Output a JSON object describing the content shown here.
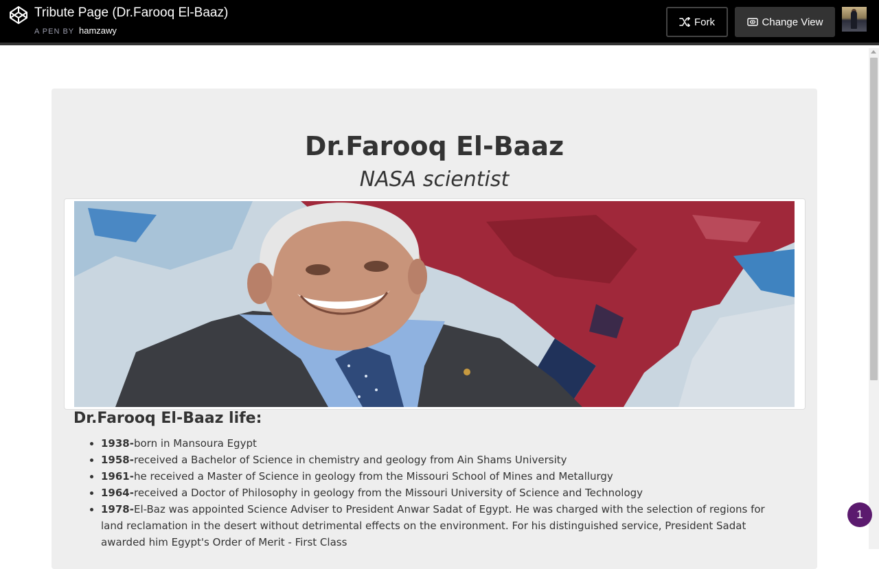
{
  "header": {
    "title": "Tribute Page (Dr.Farooq El-Baaz)",
    "byline_prefix": "A PEN BY",
    "author": "hamzawy",
    "fork_label": "Fork",
    "change_view_label": "Change View"
  },
  "tribute": {
    "title": "Dr.Farooq El-Baaz",
    "subtitle": "NASA scientist",
    "life_heading": "Dr.Farooq El-Baaz life:",
    "timeline": [
      {
        "year": "1938-",
        "text": "born in Mansoura Egypt"
      },
      {
        "year": "1958-",
        "text": "received a Bachelor of Science in chemistry and geology from Ain Shams University"
      },
      {
        "year": "1961-",
        "text": "he received a Master of Science in geology from the Missouri School of Mines and Metallurgy"
      },
      {
        "year": "1964-",
        "text": "received a Doctor of Philosophy in geology from the Missouri University of Science and Technology"
      },
      {
        "year": "1978-",
        "text": "El-Baz was appointed Science Adviser to President Anwar Sadat of Egypt. He was charged with the selection of regions for land reclamation in the desert without detrimental effects on the environment. For his distinguished service, President Sadat awarded him Egypt's Order of Merit - First Class"
      }
    ]
  },
  "notification_badge": "1",
  "colors": {
    "header_bg": "#000000",
    "panel_bg": "#eeeeee",
    "text": "#333333",
    "badge": "#5b1a6e"
  },
  "icons": {
    "logo": "codepen-logo-icon",
    "fork": "fork-icon",
    "change_view": "eye-icon"
  }
}
